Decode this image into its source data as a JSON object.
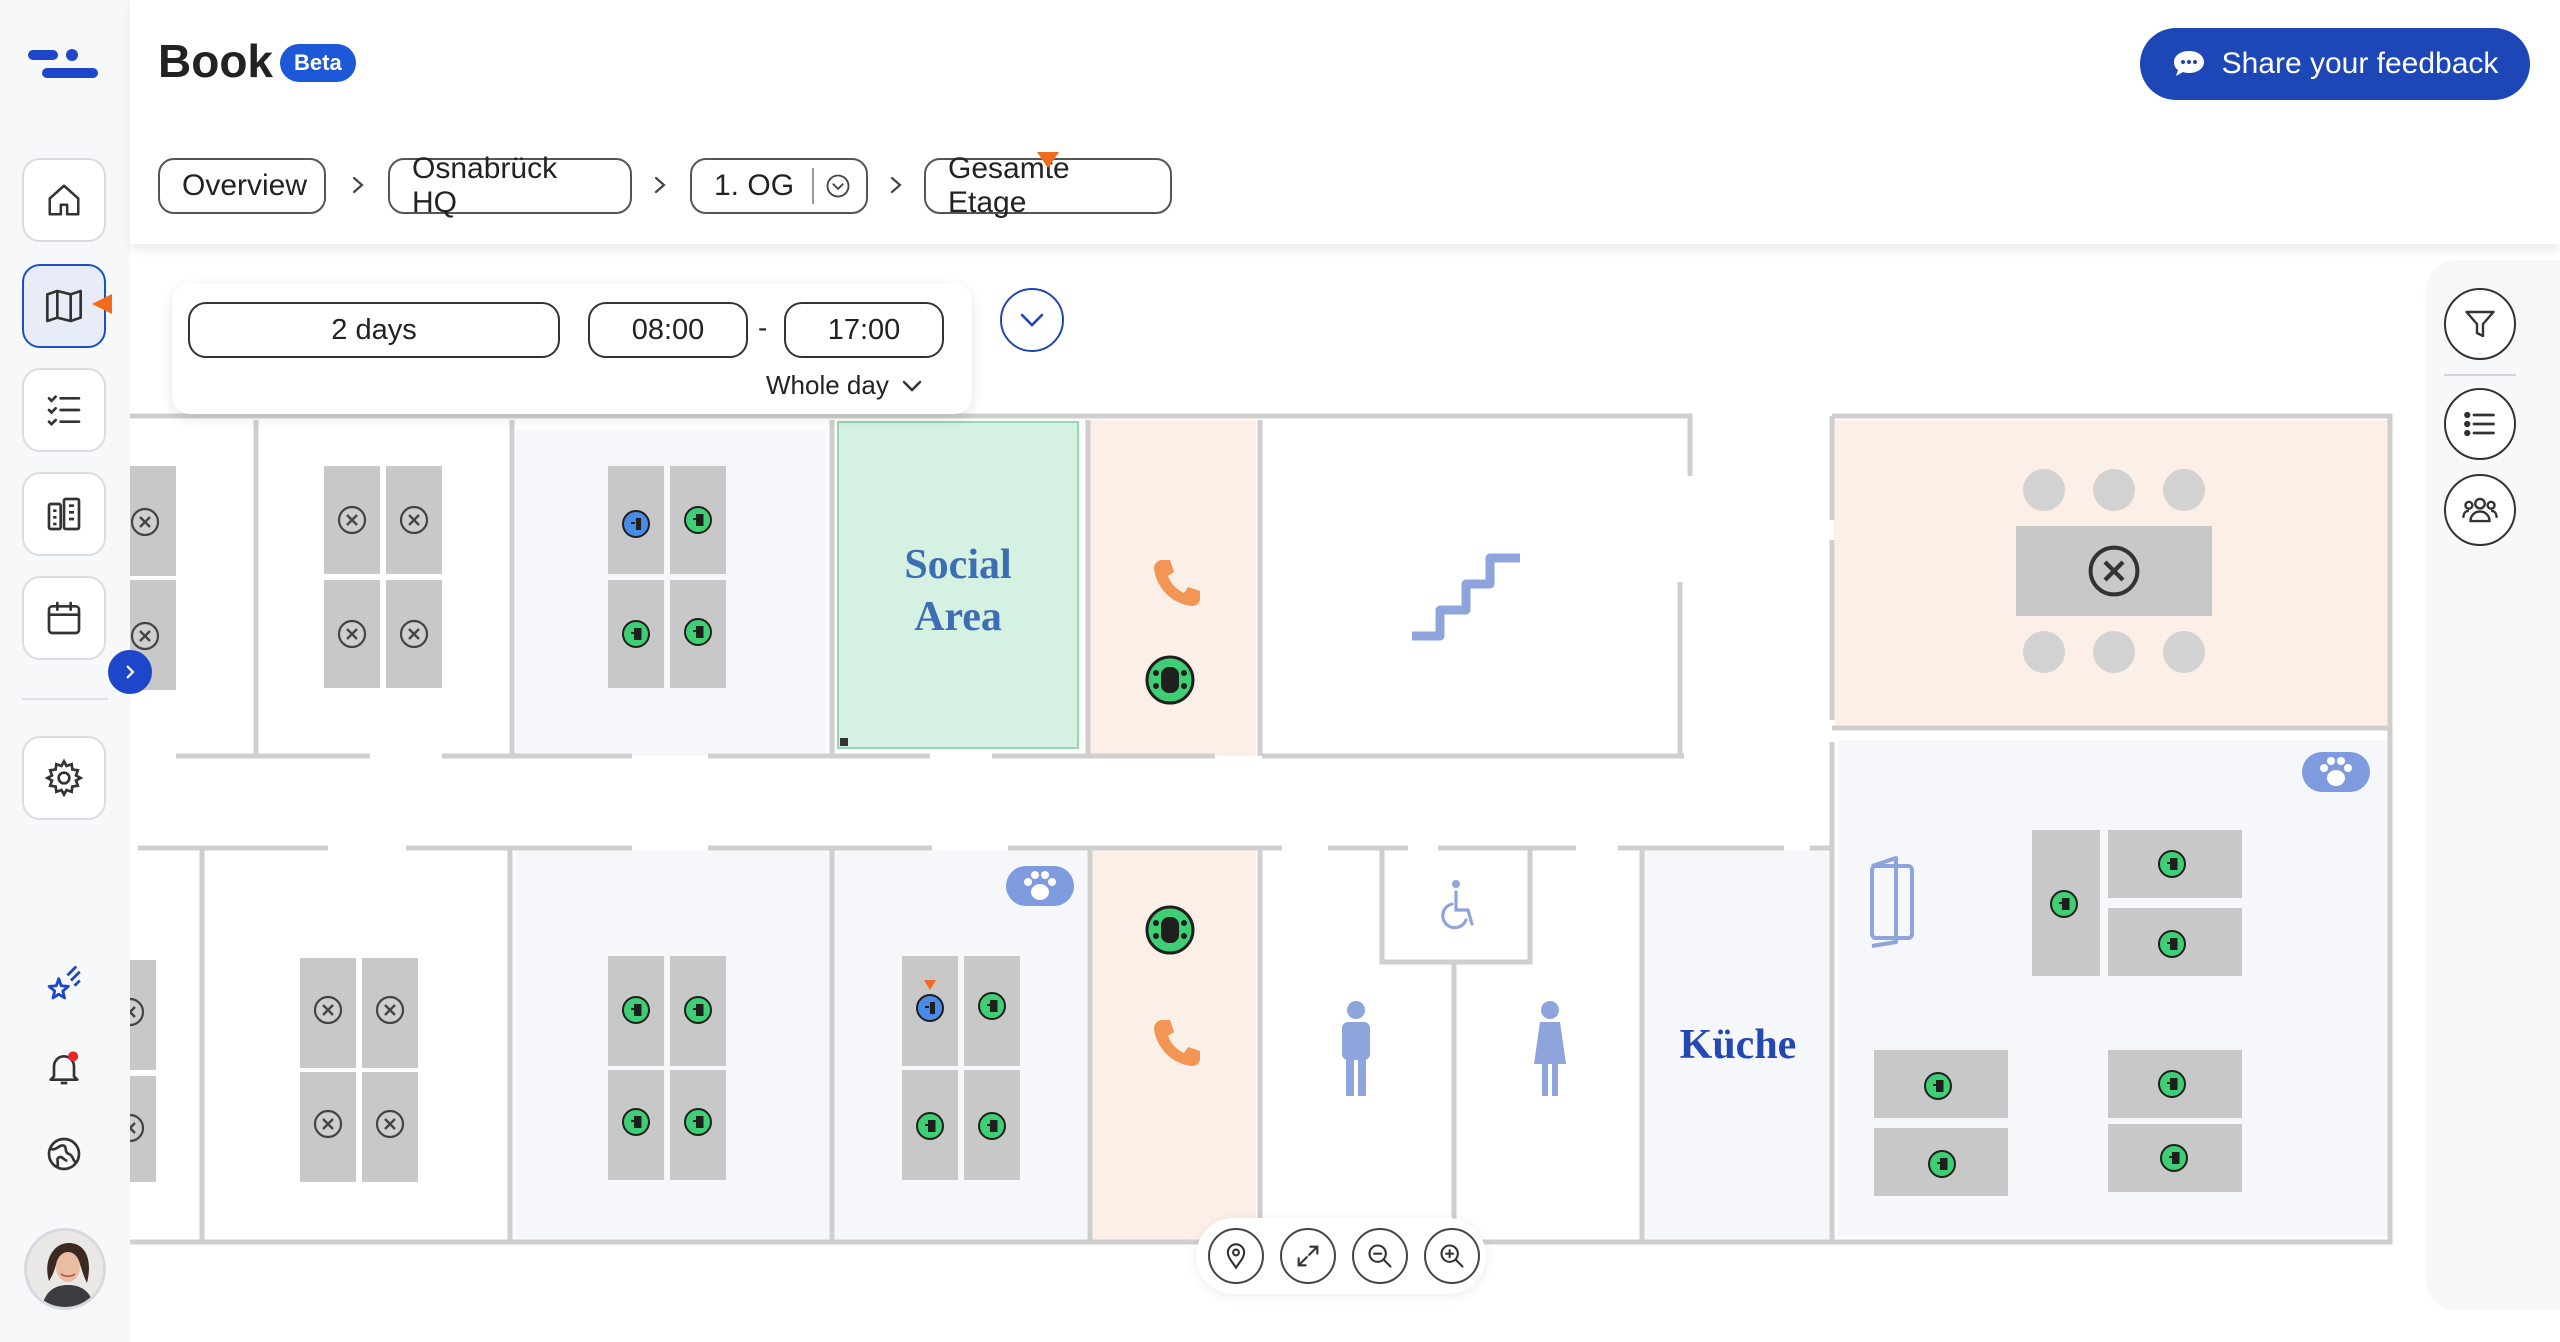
{
  "app": {
    "title": "Book",
    "badge": "Beta",
    "feedback_label": "Share your feedback"
  },
  "breadcrumbs": [
    {
      "label": "Overview"
    },
    {
      "label": "Osnabrück HQ"
    },
    {
      "label": "1. OG"
    },
    {
      "label": "Gesamte Etage"
    }
  ],
  "time": {
    "duration": "2 days",
    "start": "08:00",
    "separator": "-",
    "end": "17:00",
    "mode": "Whole day"
  },
  "map": {
    "social_area_line1": "Social",
    "social_area_line2": "Area",
    "kitchen_label": "Küche"
  },
  "sidebar": {
    "items": [
      {
        "icon": "home-icon"
      },
      {
        "icon": "map-icon",
        "active": true
      },
      {
        "icon": "checklist-icon"
      },
      {
        "icon": "building-icon"
      },
      {
        "icon": "calendar-icon"
      },
      {
        "icon": "settings-icon"
      }
    ],
    "extras": [
      {
        "icon": "sparkle-icon"
      },
      {
        "icon": "bell-icon"
      },
      {
        "icon": "globe-icon"
      }
    ]
  },
  "colors": {
    "accent": "#1d47b6",
    "free": "#2ec866",
    "booked": "#5a5a5a",
    "mine": "#3a7de0",
    "social_area": "#d5f1e1",
    "phone_booth": "#fcefe8",
    "meeting_room": "#fcefe8",
    "desk": "#c8c8c8",
    "wall": "#cfcfcf",
    "phone": "#f39554",
    "stairs": "#8ea4dc"
  }
}
